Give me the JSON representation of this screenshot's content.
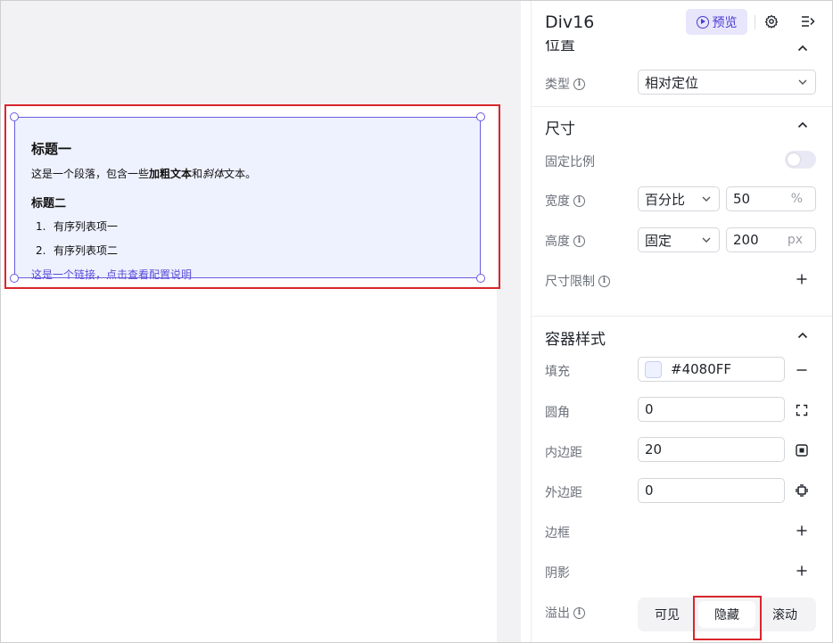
{
  "component": {
    "heading1": "标题一",
    "paragraph_pre": "这是一个段落，包含一些",
    "paragraph_bold": "加粗文本",
    "paragraph_mid": "和",
    "paragraph_italic": "斜体",
    "paragraph_post": "文本。",
    "heading2": "标题二",
    "list": [
      {
        "num": "1.",
        "text": "有序列表项一"
      },
      {
        "num": "2.",
        "text": "有序列表项二"
      }
    ],
    "link": "这是一个链接，点击查看配置说明"
  },
  "panel": {
    "title": "Div16",
    "preview_label": "预览",
    "position": {
      "title": "位置",
      "type_label": "类型",
      "type_value": "相对定位"
    },
    "size": {
      "title": "尺寸",
      "fixed_ratio_label": "固定比例",
      "width_label": "宽度",
      "width_mode": "百分比",
      "width_value": "50",
      "width_unit": "%",
      "height_label": "高度",
      "height_mode": "固定",
      "height_value": "200",
      "height_unit": "px",
      "limit_label": "尺寸限制"
    },
    "container": {
      "title": "容器样式",
      "fill_label": "填充",
      "fill_value": "#4080FF",
      "radius_label": "圆角",
      "radius_value": "0",
      "padding_label": "内边距",
      "padding_value": "20",
      "margin_label": "外边距",
      "margin_value": "0",
      "border_label": "边框",
      "shadow_label": "阴影",
      "overflow_label": "溢出",
      "overflow_options": [
        "可见",
        "隐藏",
        "滚动"
      ],
      "overflow_selected": "隐藏"
    }
  },
  "colors": {
    "accent": "#4b3bd1",
    "highlight": "#d9262c",
    "component_bg": "#eef2fe"
  }
}
